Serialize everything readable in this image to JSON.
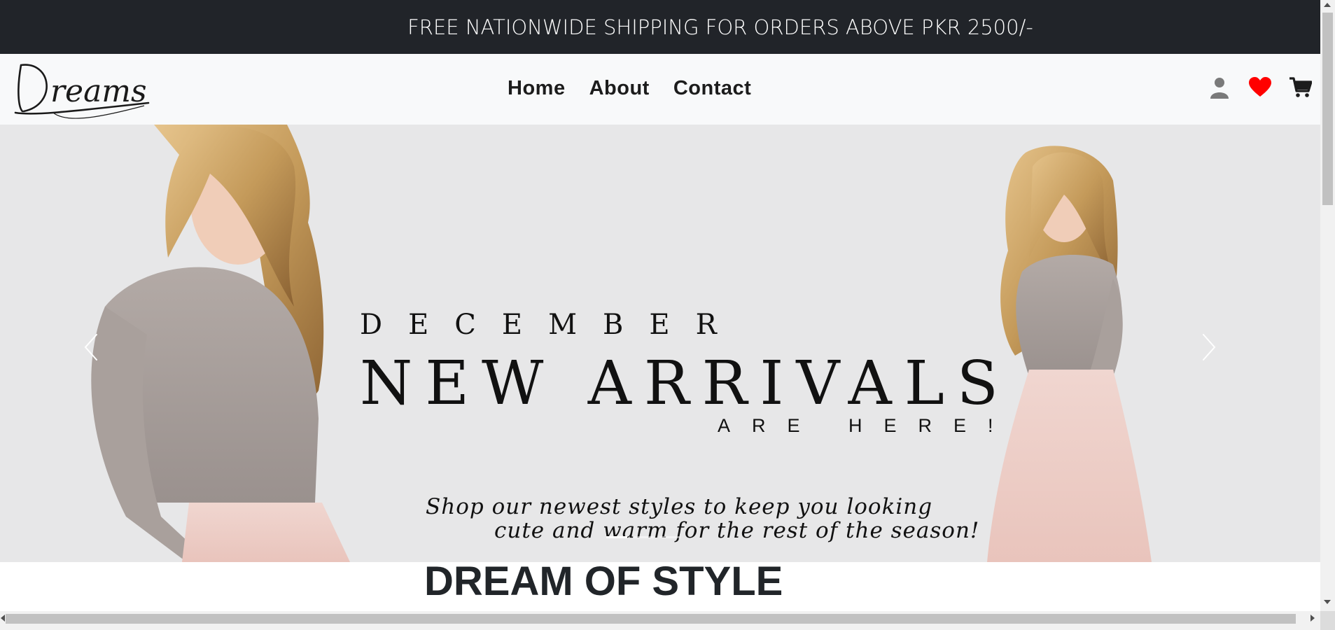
{
  "announcement": {
    "text": "FREE NATIONWIDE SHIPPING FOR ORDERS ABOVE PKR 2500/-"
  },
  "brand": {
    "name": "Dreams",
    "icon": "dreams-logo"
  },
  "nav": {
    "links": [
      {
        "label": "Home"
      },
      {
        "label": "About"
      },
      {
        "label": "Contact"
      }
    ],
    "icons": [
      {
        "name": "user-icon",
        "color": "#7a7a7a"
      },
      {
        "name": "heart-icon",
        "color": "#ff0000"
      },
      {
        "name": "cart-icon",
        "color": "#1c1c1c"
      }
    ]
  },
  "hero": {
    "month": "DECEMBER",
    "headline": "NEW ARRIVALS",
    "subheadline": "ARE HERE!",
    "copy_line1": "Shop our newest styles to keep you looking",
    "copy_line2": "cute and warm for the rest of the season!",
    "prev_label": "‹",
    "next_label": "›",
    "slides_count": 3,
    "active_slide": 1
  },
  "section": {
    "title": "DREAM OF STYLE"
  },
  "colors": {
    "topbar_bg": "#212429",
    "navbar_bg": "#f8f9fa",
    "hero_bg": "#e7e7e8",
    "heart": "#ff0000"
  }
}
